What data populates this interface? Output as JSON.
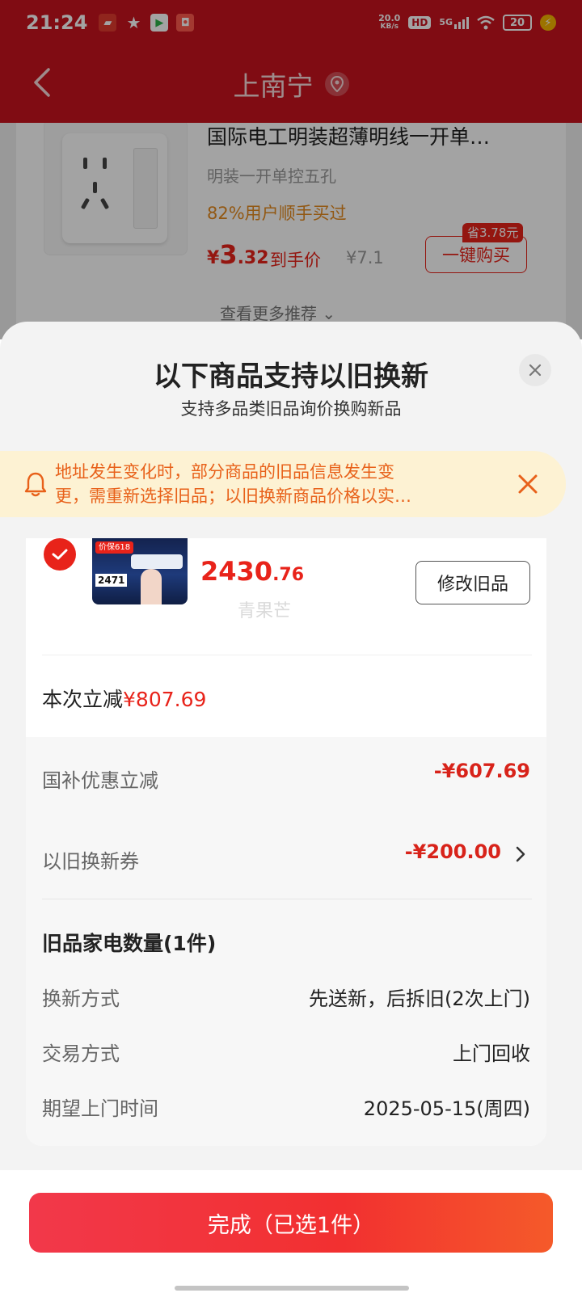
{
  "status_bar": {
    "time": "21:24",
    "net_speed_value": "20.0",
    "net_speed_unit": "KB/s",
    "hd": "HD",
    "signal": "5G",
    "battery": "20"
  },
  "nav": {
    "title": "上南宁"
  },
  "background_product": {
    "title": "国际电工明装超薄明线一开单…",
    "spec": "明装一开单控五孔",
    "bought": "82%用户顺手买过",
    "price_currency": "¥",
    "price_int": "3",
    "price_dec": ".32",
    "price_label": "到手价",
    "original_price": "¥7.1",
    "save_tag": "省3.78元",
    "buy_button": "一键购买",
    "more_recommend": "查看更多推荐"
  },
  "sheet": {
    "title": "以下商品支持以旧换新",
    "subtitle": "支持多品类旧品询价换购新品",
    "notice_line1": "地址发生变化时，部分商品的旧品信息发生变",
    "notice_line2": "更，需重新选择旧品；以旧换新商品价格以实…"
  },
  "item": {
    "img_tag": "价保618",
    "img_num": "2471",
    "price_int": "2430",
    "price_dec": ".76",
    "modify_button": "修改旧品",
    "watermark": "青果芒"
  },
  "saving": {
    "label": "本次立减",
    "amount": "¥807.69"
  },
  "breakdown": {
    "subsidy_label": "国补优惠立减",
    "subsidy_value": "-¥607.69",
    "coupon_label": "以旧换新券",
    "coupon_value": "-¥200.00",
    "old_count": "旧品家电数量(1件)",
    "rows": [
      {
        "label": "换新方式",
        "value": "先送新，后拆旧(2次上门)"
      },
      {
        "label": "交易方式",
        "value": "上门回收"
      },
      {
        "label": "期望上门时间",
        "value": "2025-05-15(周四)"
      }
    ]
  },
  "footer": {
    "done_button": "完成（已选1件）"
  },
  "colors": {
    "accent": "#e8231a",
    "header": "#c8141e",
    "notice_bg": "#fdf2d3",
    "notice_text": "#e8611a"
  }
}
